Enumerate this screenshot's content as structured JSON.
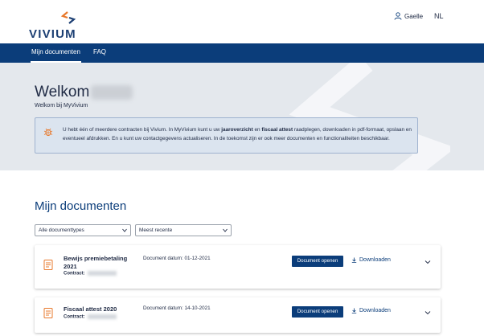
{
  "brand": {
    "name": "VIVIUM",
    "mark_color": "#e8782b",
    "primary_color": "#0b3d7a"
  },
  "header": {
    "user_label": "Gaelle",
    "language": "NL"
  },
  "nav": {
    "items": [
      {
        "label": "Mijn documenten",
        "active": true
      },
      {
        "label": "FAQ",
        "active": false
      }
    ]
  },
  "hero": {
    "title": "Welkom",
    "subtitle": "Welkom bij MyVivium",
    "info": {
      "part1": "U hebt één of meerdere contracten bij Vivium. In MyVivium kunt u uw ",
      "bold1": "jaaroverzicht",
      "part2": " en ",
      "bold2": "fiscaal attest",
      "part3": " raadplegen, downloaden in pdf-formaat, opslaan en eventueel afdrukken. En u kunt uw contactgegevens actualiseren. In de toekomst zijn er ook meer documenten en functionaliteiten beschikbaar."
    }
  },
  "documents": {
    "title": "Mijn documenten",
    "filters": {
      "type_value": "Alle documenttypes",
      "sort_value": "Meest recente"
    },
    "contract_label": "Contract:",
    "open_label": "Document openen",
    "download_label": "Downloaden",
    "items": [
      {
        "name": "Bewijs premiebetaling 2021",
        "date": "Document datum: 01-12-2021"
      },
      {
        "name": "Fiscaal attest 2020",
        "date": "Document datum: 14-10-2021"
      }
    ]
  }
}
